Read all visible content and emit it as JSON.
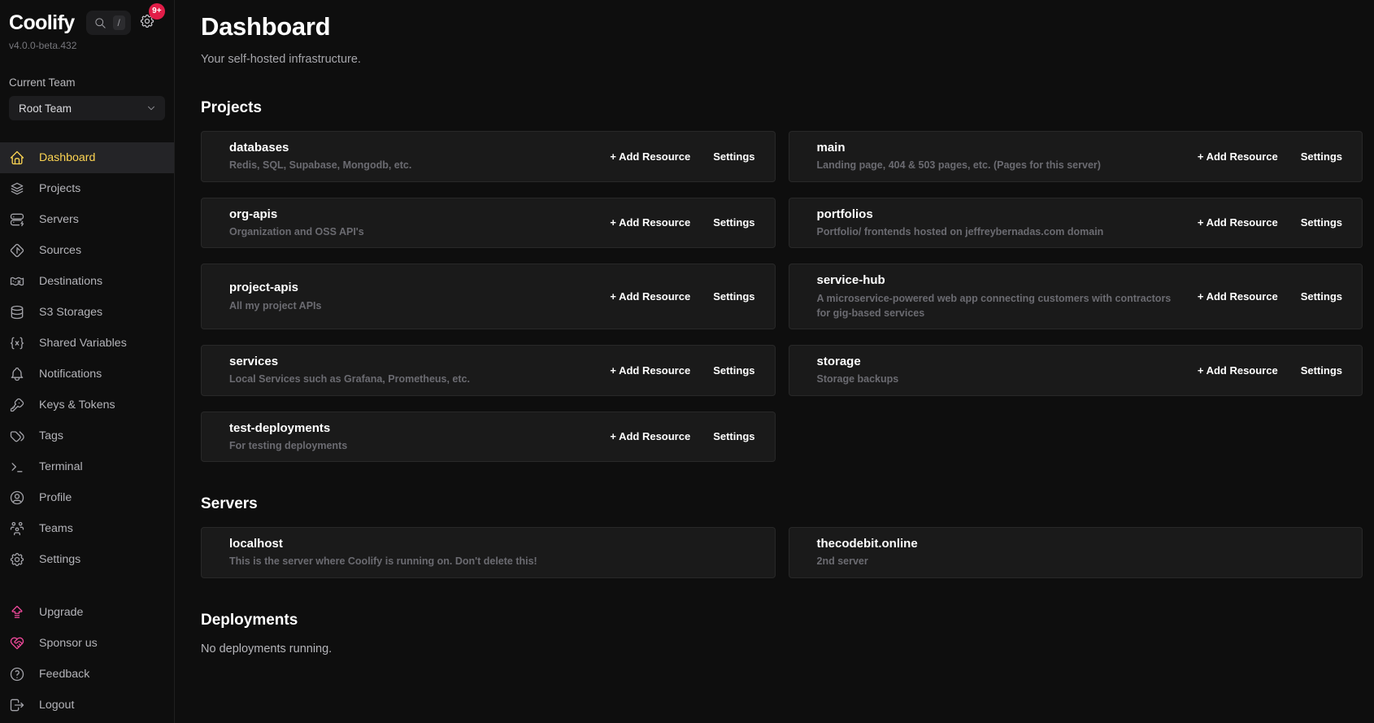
{
  "colors": {
    "page-bg": "#0e0e0e",
    "card-bg": "#1a1a1a",
    "card-border": "#282828",
    "active-item-bg": "#242427",
    "accent-yellow": "#fcd452",
    "accent-pink": "#ec4899",
    "badge-red": "#e11d48",
    "text-primary": "#ffffff",
    "text-secondary": "#b8b8bd",
    "text-muted": "#6b6b71"
  },
  "sidebar": {
    "logo": "Coolify",
    "version": "v4.0.0-beta.432",
    "search_shortcut": "/",
    "notifications_badge": "9+",
    "current_team_label": "Current Team",
    "team_select_value": "Root Team",
    "nav": [
      {
        "label": "Dashboard",
        "icon": "home-icon",
        "active": true
      },
      {
        "label": "Projects",
        "icon": "layers-icon"
      },
      {
        "label": "Servers",
        "icon": "server-icon"
      },
      {
        "label": "Sources",
        "icon": "git-icon"
      },
      {
        "label": "Destinations",
        "icon": "destination-icon"
      },
      {
        "label": "S3 Storages",
        "icon": "database-icon"
      },
      {
        "label": "Shared Variables",
        "icon": "braces-x-icon"
      },
      {
        "label": "Notifications",
        "icon": "bell-icon"
      },
      {
        "label": "Keys & Tokens",
        "icon": "key-icon"
      },
      {
        "label": "Tags",
        "icon": "tags-icon"
      },
      {
        "label": "Terminal",
        "icon": "terminal-icon"
      },
      {
        "label": "Profile",
        "icon": "user-circle-icon"
      },
      {
        "label": "Teams",
        "icon": "users-icon"
      },
      {
        "label": "Settings",
        "icon": "gear-icon"
      }
    ],
    "secondary_nav": [
      {
        "label": "Upgrade",
        "icon": "upgrade-icon",
        "accent": "pink"
      },
      {
        "label": "Sponsor us",
        "icon": "heart-handshake-icon",
        "accent": "pink"
      },
      {
        "label": "Feedback",
        "icon": "help-icon"
      },
      {
        "label": "Logout",
        "icon": "logout-icon"
      }
    ]
  },
  "header": {
    "title": "Dashboard",
    "subtitle": "Your self-hosted infrastructure."
  },
  "projects": {
    "heading": "Projects",
    "add_resource_label": "+ Add Resource",
    "settings_label": "Settings",
    "items": [
      {
        "name": "databases",
        "description": "Redis, SQL, Supabase, Mongodb, etc."
      },
      {
        "name": "main",
        "description": "Landing page, 404 & 503 pages, etc. (Pages for this server)"
      },
      {
        "name": "org-apis",
        "description": "Organization and OSS API's"
      },
      {
        "name": "portfolios",
        "description": "Portfolio/ frontends hosted on jeffreybernadas.com domain"
      },
      {
        "name": "project-apis",
        "description": "All my project APIs"
      },
      {
        "name": "service-hub",
        "description": "A microservice-powered web app connecting customers with contractors for gig-based services"
      },
      {
        "name": "services",
        "description": "Local Services such as Grafana, Prometheus, etc."
      },
      {
        "name": "storage",
        "description": "Storage backups"
      },
      {
        "name": "test-deployments",
        "description": "For testing deployments"
      }
    ]
  },
  "servers": {
    "heading": "Servers",
    "items": [
      {
        "name": "localhost",
        "description": "This is the server where Coolify is running on. Don't delete this!"
      },
      {
        "name": "thecodebit.online",
        "description": "2nd server"
      }
    ]
  },
  "deployments": {
    "heading": "Deployments",
    "empty_message": "No deployments running."
  }
}
